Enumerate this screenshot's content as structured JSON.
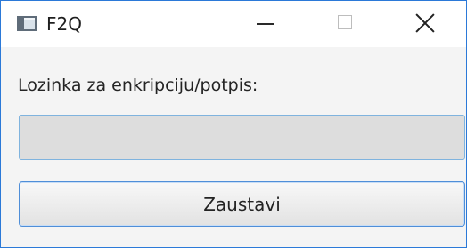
{
  "window": {
    "title": "F2Q",
    "icons": {
      "app": "application-window-icon",
      "minimize": "minimize-icon",
      "maximize": "maximize-icon",
      "close": "close-icon"
    }
  },
  "form": {
    "password_label": "Lozinka za enkripciju/potpis:",
    "password_value": "",
    "stop_button_label": "Zaustavi"
  },
  "colors": {
    "window_border": "#2b79d8",
    "field_border": "#7fb3de",
    "button_border": "#4f8ed8"
  }
}
